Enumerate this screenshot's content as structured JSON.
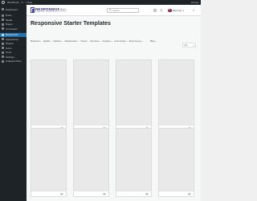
{
  "adminbar": {
    "site_name": "WordPress",
    "comments": "0",
    "new": "+ New",
    "greeting": "Howdy"
  },
  "sidebar": {
    "items": [
      {
        "label": "Dashboard",
        "icon": "dashboard-icon",
        "active": false
      },
      {
        "label": "Posts",
        "icon": "pin-icon",
        "active": false
      },
      {
        "label": "Media",
        "icon": "media-icon",
        "active": false
      },
      {
        "label": "Pages",
        "icon": "page-icon",
        "active": false
      },
      {
        "label": "Comments",
        "icon": "comment-icon",
        "active": false
      },
      {
        "label": "Responsive",
        "icon": "responsive-icon",
        "active": true
      },
      {
        "label": "Appearance",
        "icon": "brush-icon",
        "active": false
      },
      {
        "label": "Plugins",
        "icon": "plugin-icon",
        "active": false
      },
      {
        "label": "Users",
        "icon": "user-icon",
        "active": false
      },
      {
        "label": "Tools",
        "icon": "wrench-icon",
        "active": false
      },
      {
        "label": "Settings",
        "icon": "settings-icon",
        "active": false
      },
      {
        "label": "Collapse Menu",
        "icon": "collapse-icon",
        "active": false
      }
    ]
  },
  "topbar": {
    "brand": "RESPONSIVE",
    "brand_sub": "STARTER TEMPLATES",
    "version": "Beta",
    "search_placeholder": "Search",
    "builder_initial": "E",
    "builder_label": "Elementor",
    "close": "×"
  },
  "page": {
    "title": "Responsive Starter Templates"
  },
  "filters": [
    {
      "label": "Business"
    },
    {
      "label": "Health"
    },
    {
      "label": "Fashion"
    },
    {
      "label": "Restaurants"
    },
    {
      "label": "Travel"
    },
    {
      "label": "Services"
    },
    {
      "label": "Creative"
    },
    {
      "label": "Community"
    },
    {
      "label": "Ecommerce"
    },
    {
      "label": "Blog"
    }
  ],
  "type_select": {
    "value": "ALL"
  },
  "colors": {
    "admin_dark": "#1d2327",
    "accent": "#2271b1",
    "brand": "#2c2c6e",
    "card_placeholder": "#e9e9ea"
  }
}
